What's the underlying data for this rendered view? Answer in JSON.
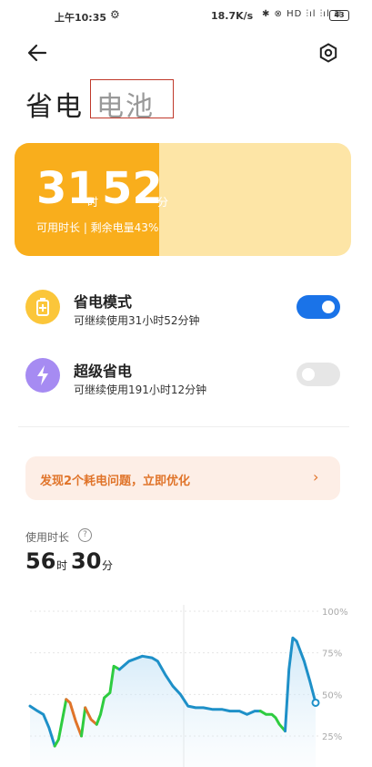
{
  "status_bar": {
    "time": "上午10:35",
    "network_speed": "18.7K/s",
    "signal_icons": "✱ ⊗ HD ⫶ıl ⫶ıl ≋",
    "battery_level": "43"
  },
  "header": {
    "title": "省电",
    "subtitle": "电池"
  },
  "battery_card": {
    "hours": "31",
    "hours_unit": "时",
    "minutes": "52",
    "minutes_unit": "分",
    "info": "可用时长 | 剩余电量43%",
    "level": 0.43
  },
  "modes": [
    {
      "title": "省电模式",
      "desc": "可继续使用31小时52分钟",
      "enabled": true
    },
    {
      "title": "超级省电",
      "desc": "可继续使用191小时12分钟",
      "enabled": false
    }
  ],
  "issue_banner": {
    "text": "发现2个耗电问题，立即优化",
    "chevron": "›"
  },
  "usage": {
    "label": "使用时长",
    "help_icon": "?",
    "hours": "56",
    "hours_unit": "时",
    "minutes": "30",
    "minutes_unit": "分"
  },
  "colors": {
    "card_fill": "#f9ae1c",
    "card_bg": "#fde5a6",
    "toggle_on": "#1a73e8",
    "line_discharge": "#1e90c8",
    "line_charge": "#2ecc40",
    "line_fast_drain": "#e0742a"
  },
  "chart_data": {
    "type": "line",
    "y_ticks": [
      "100%",
      "75%",
      "50%",
      "25%"
    ],
    "ylim": [
      0,
      100
    ],
    "grid": true,
    "points": [
      [
        0,
        43
      ],
      [
        4,
        40
      ],
      [
        7,
        38
      ],
      [
        10,
        30
      ],
      [
        13,
        19
      ],
      [
        15,
        23
      ],
      [
        19,
        47
      ],
      [
        21,
        45
      ],
      [
        24,
        34
      ],
      [
        27,
        25
      ],
      [
        29,
        42
      ],
      [
        32,
        35
      ],
      [
        35,
        32
      ],
      [
        37,
        38
      ],
      [
        39,
        48
      ],
      [
        42,
        51
      ],
      [
        44,
        67
      ],
      [
        47,
        65
      ],
      [
        52,
        70
      ],
      [
        59,
        73
      ],
      [
        64,
        72
      ],
      [
        67,
        70
      ],
      [
        71,
        62
      ],
      [
        75,
        55
      ],
      [
        79,
        50
      ],
      [
        83,
        43
      ],
      [
        87,
        42
      ],
      [
        91,
        42
      ],
      [
        96,
        41
      ],
      [
        101,
        41
      ],
      [
        105,
        40
      ],
      [
        110,
        40
      ],
      [
        114,
        38
      ],
      [
        118,
        40
      ],
      [
        121,
        40
      ],
      [
        124,
        38
      ],
      [
        127,
        38
      ],
      [
        129,
        36
      ],
      [
        131,
        32
      ],
      [
        134,
        28
      ],
      [
        136,
        65
      ],
      [
        138,
        84
      ],
      [
        140,
        82
      ],
      [
        144,
        70
      ],
      [
        147,
        58
      ],
      [
        150,
        45
      ]
    ],
    "segments": [
      {
        "from": 0,
        "to": 4,
        "kind": "discharge"
      },
      {
        "from": 4,
        "to": 6,
        "kind": "charge"
      },
      {
        "from": 6,
        "to": 9,
        "kind": "fast_drain"
      },
      {
        "from": 9,
        "to": 10,
        "kind": "charge"
      },
      {
        "from": 10,
        "to": 12,
        "kind": "fast_drain"
      },
      {
        "from": 12,
        "to": 17,
        "kind": "charge"
      },
      {
        "from": 17,
        "to": 34,
        "kind": "discharge"
      },
      {
        "from": 34,
        "to": 39,
        "kind": "charge"
      },
      {
        "from": 39,
        "to": 45,
        "kind": "discharge"
      }
    ]
  }
}
